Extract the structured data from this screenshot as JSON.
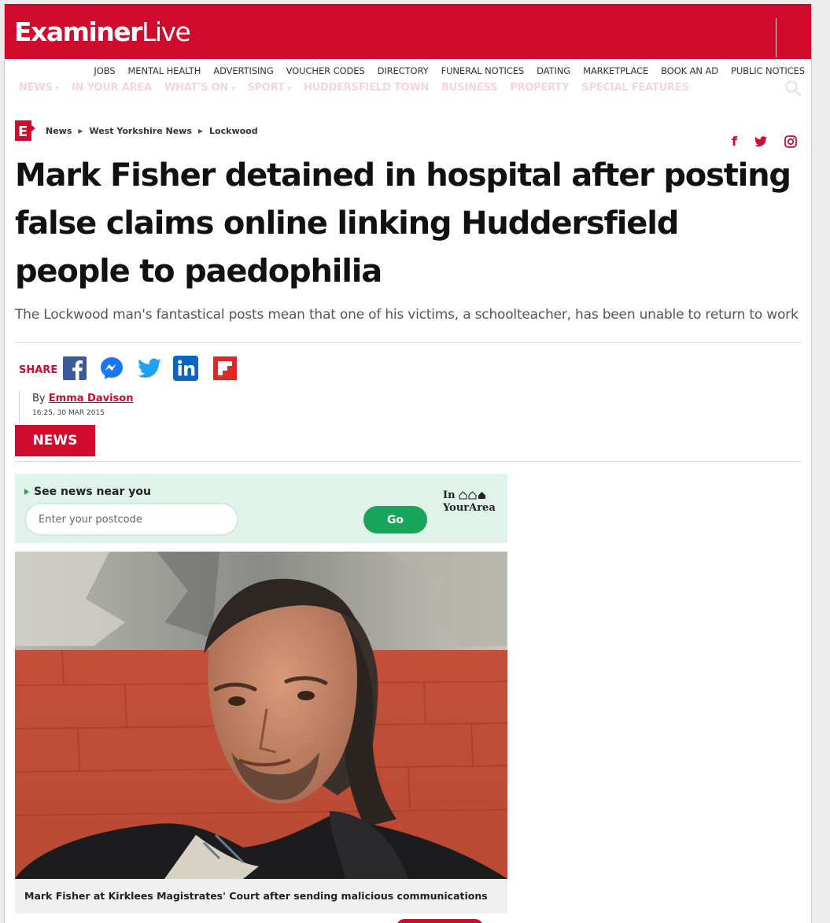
{
  "header": {
    "logo_bold": "Examiner",
    "logo_light": "Live",
    "colors": {
      "brand": "#cf0a2c",
      "accent_green": "#19a45b"
    }
  },
  "util_nav": [
    "JOBS",
    "MENTAL HEALTH",
    "ADVERTISING",
    "VOUCHER CODES",
    "DIRECTORY",
    "FUNERAL NOTICES",
    "DATING",
    "MARKETPLACE",
    "BOOK AN AD",
    "PUBLIC NOTICES"
  ],
  "main_nav": [
    {
      "label": "NEWS",
      "caret": "▾"
    },
    {
      "label": "IN YOUR AREA",
      "caret": ""
    },
    {
      "label": "WHAT'S ON",
      "caret": "▾"
    },
    {
      "label": "SPORT",
      "caret": "▾"
    },
    {
      "label": "HUDDERSFIELD TOWN",
      "caret": ""
    },
    {
      "label": "BUSINESS",
      "caret": ""
    },
    {
      "label": "PROPERTY",
      "caret": ""
    },
    {
      "label": "SPECIAL FEATURES",
      "caret": ""
    }
  ],
  "breadcrumb": {
    "logo_letter": "E",
    "items": [
      "News",
      "West Yorkshire News",
      "Lockwood"
    ],
    "separator": "▶"
  },
  "social_top": {
    "facebook": "f",
    "twitter_icon": "twitter-icon",
    "instagram_icon": "instagram-icon"
  },
  "article": {
    "headline": "Mark Fisher detained in hospital after posting false claims online linking Huddersfield people to paedophilia",
    "standfirst": "The Lockwood man's fantastical posts mean that one of his victims, a schoolteacher, has been unable to return to work",
    "share_label": "SHARE",
    "byline_prefix": "By",
    "author": "Emma Davison",
    "date": "16:25, 30 MAR 2015",
    "section_tag": "NEWS",
    "image_caption": "Mark Fisher at Kirklees Magistrates' Court after sending malicious communications"
  },
  "postcode_widget": {
    "title": "See news near you",
    "placeholder": "Enter your postcode",
    "button": "Go",
    "brand_line1": "In",
    "brand_line2": "YourArea"
  }
}
